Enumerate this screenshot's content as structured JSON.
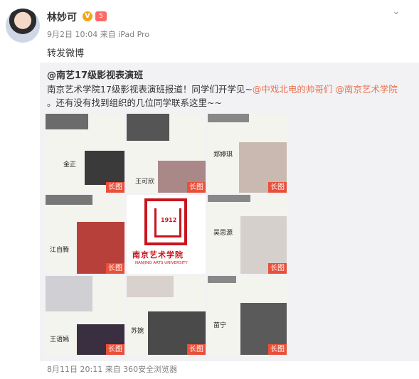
{
  "post": {
    "author": "林妙可",
    "badge_v": "V",
    "badge_level": "5",
    "meta": "9月2日 10:04 来自 iPad Pro",
    "text": "转发微博"
  },
  "quoted": {
    "author": "@南艺17级影视表演班",
    "text_before": "南京艺术学院17级影视表演班报道！同学们开学见~",
    "mention1": "@中戏北电的帅哥们",
    "mention2": "@南京艺术学院",
    "text_after": "。还有没有找到组织的几位同学联系这里~~",
    "image_tag": "长图",
    "signatures": [
      "金正",
      "王可欣",
      "郑婷琪",
      "江自腾",
      "吴思源",
      "王语嫣",
      "苏婉",
      "苗宁"
    ],
    "logo_cn": "南京艺术学院",
    "logo_en": "NANJING ARTS UNIVERSITY",
    "logo_year": "1912",
    "meta": "8月11日 20:11 来自 360安全浏览器"
  },
  "icons": {
    "menu": "chevron-down-icon"
  }
}
